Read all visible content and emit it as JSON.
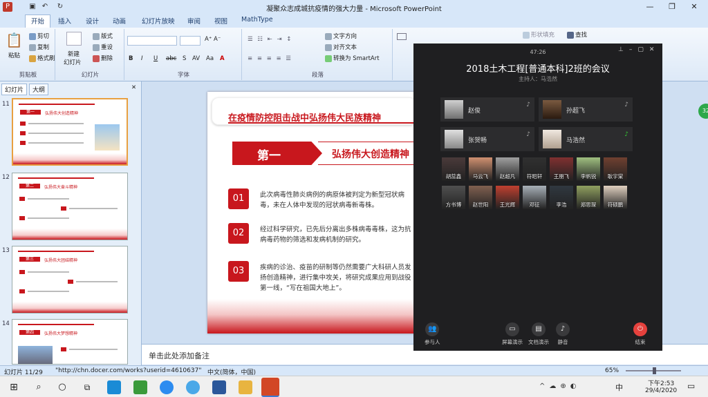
{
  "window": {
    "title": "凝聚众志成城抗疫情的强大力量 - Microsoft PowerPoint",
    "controls": [
      "—",
      "❐",
      "✕"
    ]
  },
  "ribbon_tabs": [
    "开始",
    "插入",
    "设计",
    "动画",
    "幻灯片放映",
    "审阅",
    "视图",
    "MathType"
  ],
  "clipboard": {
    "paste": "粘贴",
    "cut": "剪切",
    "copy": "复制",
    "format_painter": "格式刷",
    "label": "剪贴板"
  },
  "slides_group": {
    "new_slide": "新建",
    "new_slide2": "幻灯片",
    "layout": "版式",
    "reset": "重设",
    "delete": "删除",
    "label": "幻灯片"
  },
  "font_group": {
    "label": "字体",
    "bold": "B",
    "italic": "I",
    "underline": "U",
    "strike": "abc",
    "shadow": "S",
    "spacing": "AV",
    "case": "Aa",
    "color": "A"
  },
  "para_group": {
    "label": "段落",
    "text_dir": "文字方向",
    "align_text": "对齐文本",
    "smartart": "转换为 SmartArt"
  },
  "drawing_group": {
    "fill": "形状填充",
    "find": "查找"
  },
  "left_pane": {
    "tab_slides": "幻灯片",
    "tab_outline": "大纲",
    "close": "✕",
    "thumbs": [
      {
        "num": "11",
        "head": "第一",
        "title": "弘扬伟大创造精神"
      },
      {
        "num": "12",
        "head": "第二",
        "title": "弘扬伟大奋斗精神"
      },
      {
        "num": "13",
        "head": "第三",
        "title": "弘扬伟大团结精神"
      },
      {
        "num": "14",
        "head": "第四",
        "title": "弘扬伟大梦想精神"
      }
    ]
  },
  "slide": {
    "title": "在疫情防控阻击战中弘扬伟大民族精神",
    "section_num": "第一",
    "section_title": "弘扬伟大创造精神",
    "items": [
      {
        "num": "01",
        "text": "此次病毒性肺炎病例的病原体被判定为新型冠状病毒，未在人体中发现的冠状病毒新毒株。"
      },
      {
        "num": "02",
        "text": "经过科学研究，已先后分离出多株病毒毒株，这为抗病毒药物的筛选和发病机制的研究。"
      },
      {
        "num": "03",
        "text": "疾病的诊治、疫苗的研制等仍然需要广大科研人员发扬创造精神，进行集中攻关，将研究成果应用到战役第一线，“写在祖国大地上”。"
      }
    ]
  },
  "notes_placeholder": "单击此处添加备注",
  "status": {
    "slide": "幻灯片 11/29",
    "theme": "\"http://chn.docer.com/works?userid=4610637\"",
    "lang": "中文(简体，中国)",
    "zoom": "65%"
  },
  "meeting": {
    "time": "47:26",
    "title": "2018土木工程[普通本科]2班的会议",
    "host": "主持人：马浩然",
    "main": [
      {
        "name": "赵俊",
        "color": "#b0b0b0"
      },
      {
        "name": "孙超飞",
        "color": "#5a4030"
      },
      {
        "name": "张贺畅",
        "color": "#c8c8c8"
      },
      {
        "name": "马浩然",
        "color": "#e8e0d8"
      }
    ],
    "grid": [
      {
        "name": "胡蕊鑫",
        "color": "#4a3a3a"
      },
      {
        "name": "马云飞",
        "color": "#d09070"
      },
      {
        "name": "赵超凡",
        "color": "#a0a0a0"
      },
      {
        "name": "符昭轩",
        "color": "#303030"
      },
      {
        "name": "王朋飞",
        "color": "#803030"
      },
      {
        "name": "李帆锐",
        "color": "#a0c080"
      },
      {
        "name": "耿宇棠",
        "color": "#704030"
      },
      {
        "name": "方书博",
        "color": "#505050"
      },
      {
        "name": "赵世阳",
        "color": "#806050"
      },
      {
        "name": "王光辉",
        "color": "#c04030"
      },
      {
        "name": "邓征",
        "color": "#a8b0b8"
      },
      {
        "name": "李浩",
        "color": "#303840"
      },
      {
        "name": "郑思琛",
        "color": "#90a060"
      },
      {
        "name": "符硕鹏",
        "color": "#e0d0c0"
      }
    ],
    "buttons": {
      "participants": "参与人",
      "screen": "屏幕演示",
      "doc": "文档演示",
      "mute": "静音",
      "end": "结束"
    }
  },
  "taskbar": {
    "time": "下午2:53",
    "date": "29/4/2020",
    "ime": "中"
  },
  "colors": {
    "red": "#c8171d",
    "ribbon": "#d7e7f9",
    "meet_bg": "#1f1f21"
  }
}
